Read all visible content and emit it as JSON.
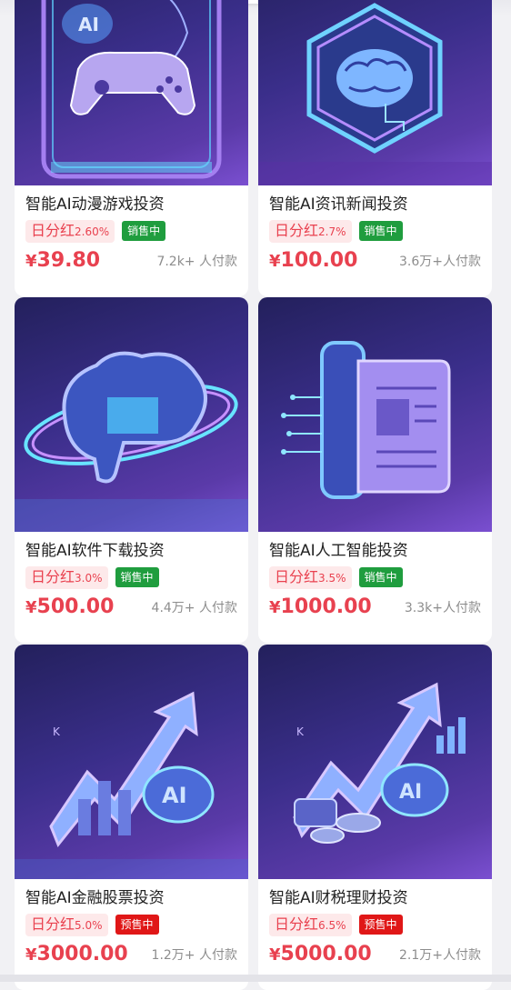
{
  "products": [
    {
      "title": "智能AI动漫游戏投资",
      "dividend_label": "日分红",
      "dividend_rate": "2.60%",
      "status": "销售中",
      "status_color": "#1f9d3e",
      "price_symbol": "¥",
      "price": "39.80",
      "buyers": "7.2k+ 人付款",
      "image_icon": "gamepad-ai-icon"
    },
    {
      "title": "智能AI资讯新闻投资",
      "dividend_label": "日分红",
      "dividend_rate": "2.7%",
      "status": "销售中",
      "status_color": "#1f9d3e",
      "price_symbol": "¥",
      "price": "100.00",
      "buyers": "3.6万+人付款",
      "image_icon": "brain-hexagon-icon"
    },
    {
      "title": "智能AI软件下载投资",
      "dividend_label": "日分红",
      "dividend_rate": "3.0%",
      "status": "销售中",
      "status_color": "#1f9d3e",
      "price_symbol": "¥",
      "price": "500.00",
      "buyers": "4.4万+ 人付款",
      "image_icon": "brain-orbit-icon"
    },
    {
      "title": "智能AI人工智能投资",
      "dividend_label": "日分红",
      "dividend_rate": "3.5%",
      "status": "销售中",
      "status_color": "#1f9d3e",
      "price_symbol": "¥",
      "price": "1000.00",
      "buyers": "3.3k+人付款",
      "image_icon": "document-circuit-icon"
    },
    {
      "title": "智能AI金融股票投资",
      "dividend_label": "日分红",
      "dividend_rate": "5.0%",
      "status": "预售中",
      "status_color": "#e01717",
      "price_symbol": "¥",
      "price": "3000.00",
      "buyers": "1.2万+ 人付款",
      "image_icon": "stock-arrow-ai-icon"
    },
    {
      "title": "智能AI财税理财投资",
      "dividend_label": "日分红",
      "dividend_rate": "6.5%",
      "status": "预售中",
      "status_color": "#e01717",
      "price_symbol": "¥",
      "price": "5000.00",
      "buyers": "2.1万+人付款",
      "image_icon": "finance-arrow-ai-icon"
    }
  ]
}
